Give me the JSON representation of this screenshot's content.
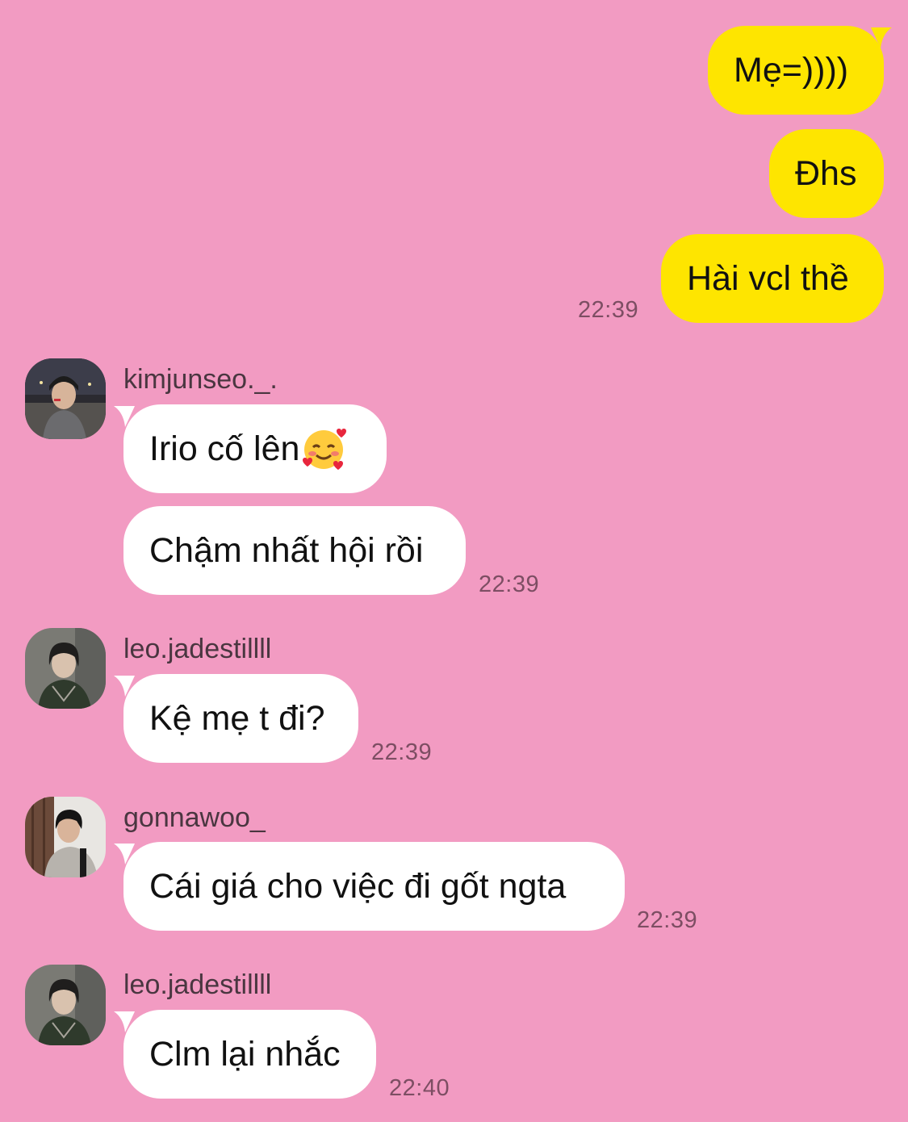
{
  "colors": {
    "background": "#f29bc2",
    "outgoing_bubble": "#fee500",
    "incoming_bubble": "#ffffff",
    "timestamp": "#7d4e63"
  },
  "outgoing": {
    "messages": [
      "Mẹ=))))",
      "Đhs",
      "Hài vcl thề"
    ],
    "time": "22:39"
  },
  "groups": [
    {
      "sender": "kimjunseo._.",
      "messages": [
        "Irio cố lên",
        "Chậm nhất hội rồi"
      ],
      "emoji": "smiling-face-with-hearts",
      "time": "22:39"
    },
    {
      "sender": "leo.jadestillll",
      "messages": [
        "Kệ mẹ t đi?"
      ],
      "time": "22:39"
    },
    {
      "sender": "gonnawoo_",
      "messages": [
        "Cái giá cho việc đi gốt ngta"
      ],
      "time": "22:39"
    },
    {
      "sender": "leo.jadestillll",
      "messages": [
        "Clm lại nhắc"
      ],
      "time": "22:40"
    }
  ]
}
